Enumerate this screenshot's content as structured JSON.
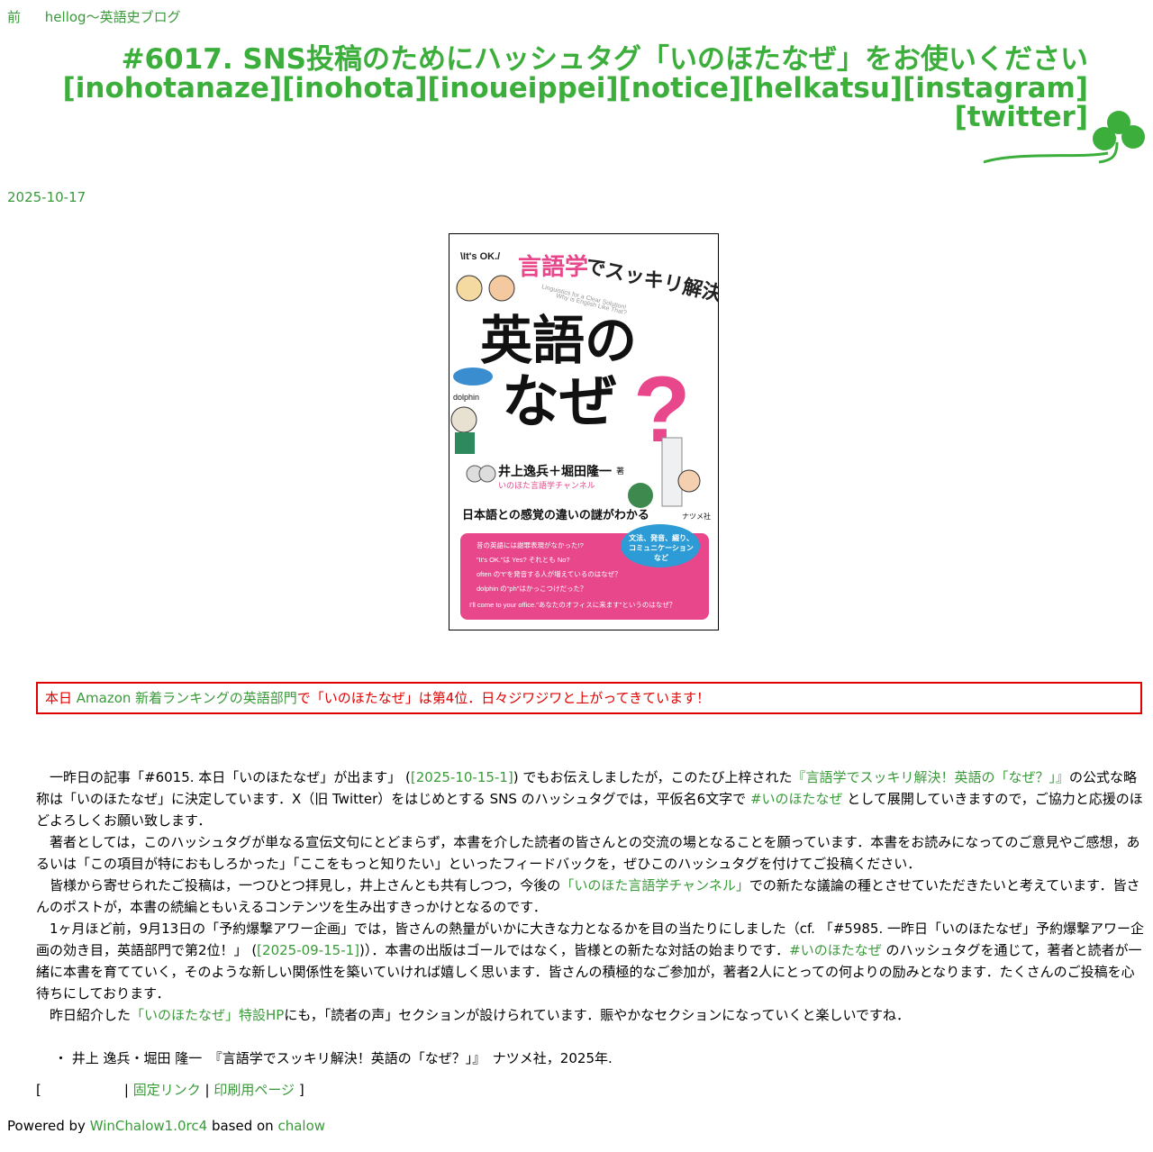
{
  "nav": {
    "prev_label": "前",
    "blog_label": "hellog〜英語史ブログ"
  },
  "title": {
    "line1": "#6017. SNS投稿のためにハッシュタグ「いのほたなぜ」をお使いください",
    "line2": "[inohotanaze][inohota][inoueippei][notice][helkatsu][instagram]",
    "line3": "[twitter]"
  },
  "date": "2025-10-17",
  "book": {
    "its_ok": "\\It's OK./",
    "tagline_pink": "言語学",
    "tagline_rest": "でスッキリ解決!",
    "subtitle_en1": "Linguistics for a Clear Solution!",
    "subtitle_en2": "Why is English Like That?",
    "main_title_1": "英語の",
    "main_title_2": "なぜ",
    "question_mark": "?",
    "dolphin": "dolphin",
    "authors": "井上逸兵＋堀田隆一",
    "author_suffix": "著",
    "channel": "いのほた言語学チャンネル",
    "headline": "日本語との感覚の違いの謎がわかる",
    "publisher": "ナツメ社",
    "bubble": "文法、発音、綴り、コミュニケーションなど",
    "items": [
      "昔の英語には謝罪表現がなかった!?",
      "\"It's OK.\"は Yes? それとも No?",
      "often の\"t\"を発音する人が増えているのはなぜ？",
      "dolphin の\"ph\"はかっこつけだった？",
      "I'll come to your office.\"あなたのオフィスに来ます\"というのはなぜ？"
    ]
  },
  "notice": {
    "part1": "本日 ",
    "link1": "Amazon 新着ランキングの英語部門",
    "part2": "で「いのほたなぜ」は第4位．日々ジワジワと上がってきています！"
  },
  "article": {
    "p1": {
      "a": "一昨日の記事「#6015. 本日「いのほたなぜ」が出ます」 (",
      "link_date": "[2025-10-15-1]",
      "b": ") でもお伝えしましたが，このたび上梓された",
      "link_book": "『言語学でスッキリ解決！英語の「なぜ？」』",
      "c": "の公式な略称は「いのほたなぜ」に決定しています．X（旧 Twitter）をはじめとする SNS のハッシュタグでは，平仮名6文字で ",
      "link_tag": "#いのほたなぜ",
      "d": " として展開していきますので，ご協力と応援のほどよろしくお願い致します．"
    },
    "p2": "著者としては，このハッシュタグが単なる宣伝文句にとどまらず，本書を介した読者の皆さんとの交流の場となることを願っています．本書をお読みになってのご意見やご感想，あるいは「この項目が特におもしろかった」「ここをもっと知りたい」といったフィードバックを，ぜひこのハッシュタグを付けてご投稿ください．",
    "p3": {
      "a": "皆様から寄せられたご投稿は，一つひとつ拝見し，井上さんとも共有しつつ，今後の",
      "link_channel": "「いのほた言語学チャンネル」",
      "b": "での新たな議論の種とさせていただきたいと考えています．皆さんのポストが，本書の続編ともいえるコンテンツを生み出すきっかけとなるのです．"
    },
    "p4": {
      "a": "1ヶ月ほど前，9月13日の「予約爆撃アワー企画」では，皆さんの熱量がいかに大きな力となるかを目の当たりにしました（cf. 「#5985. 一昨日「いのほたなぜ」予約爆撃アワー企画の効き目，英語部門で第2位！」 (",
      "link_date": "[2025-09-15-1]",
      "b": ")）．本書の出版はゴールではなく，皆様との新たな対話の始まりです．",
      "link_tag": "#いのほたなぜ",
      "c": " のハッシュタグを通じて，著者と読者が一緒に本書を育てていく，そのような新しい関係性を築いていければ嬉しく思います．皆さんの積極的なご参加が，著者2人にとっての何よりの励みとなります．たくさんのご投稿を心待ちにしております．"
    },
    "p5": {
      "a": "昨日紹介した",
      "link_hp": "「いのほたなぜ」特設HP",
      "b": "にも，「読者の声」セクションが設けられています．賑やかなセクションになっていくと楽しいですね．"
    }
  },
  "reference": "・ 井上 逸兵・堀田 隆一　『言語学でスッキリ解決！英語の「なぜ？」』　ナツメ社，2025年.",
  "links": {
    "open": "[",
    "sep1": "|",
    "permalink": "固定リンク",
    "sep2": "|",
    "print": "印刷用ページ",
    "close": "]"
  },
  "footer": {
    "powered": "Powered by ",
    "winchalow": "WinChalow1.0rc4",
    "based": " based on ",
    "chalow": "chalow"
  },
  "colors": {
    "link": "#3a9a3a",
    "title": "#3cae3c",
    "notice": "#e00000",
    "book_pink": "#e8478b"
  }
}
